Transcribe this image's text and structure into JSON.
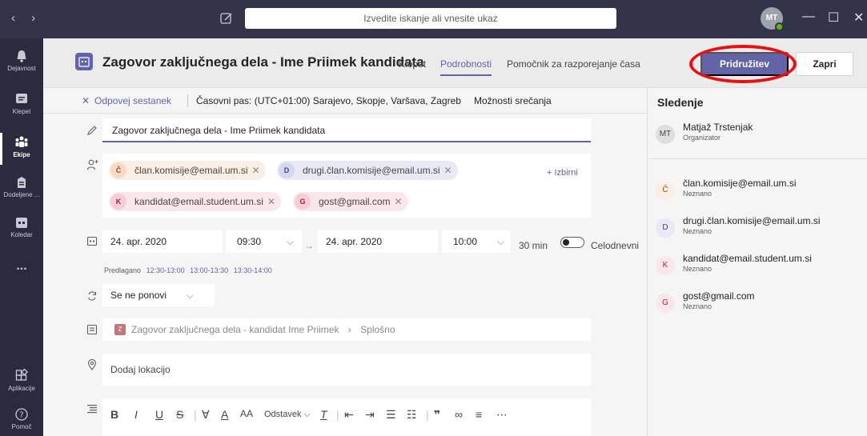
{
  "topbar": {
    "search_placeholder": "Izvedite iskanje ali vnesite ukaz",
    "user_initials": "MT",
    "nav_arrows": "‹ ›",
    "min_glyph": "—",
    "max_glyph": "☐",
    "close_glyph": "✕"
  },
  "rail": {
    "items": [
      {
        "label": "Dejavnost",
        "icon": "bell-icon"
      },
      {
        "label": "Klepet",
        "icon": "chat-icon"
      },
      {
        "label": "Ekipe",
        "icon": "teams-icon"
      },
      {
        "label": "Dodeljene ...",
        "icon": "assignments-icon"
      },
      {
        "label": "Koledar",
        "icon": "calendar-icon"
      },
      {
        "label": "...",
        "icon": "more-icon"
      },
      {
        "label": "Aplikacije",
        "icon": "apps-icon"
      },
      {
        "label": "Pomoč",
        "icon": "help-icon"
      }
    ]
  },
  "header": {
    "title": "Zagovor zaključnega dela - Ime Priimek kandidata",
    "tabs": [
      "Klepet",
      "Podrobnosti",
      "Pomočnik za razporejanje časa"
    ],
    "join_label": "Pridružitev",
    "close_label": "Zapri"
  },
  "toolbar": {
    "cancel_label": "Odpovej sestanek",
    "timezone": "Časovni pas: (UTC+01:00) Sarajevo, Skopje, Varšava, Zagreb",
    "options_label": "Možnosti srečanja"
  },
  "form": {
    "title_value": "Zagovor zaključnega dela - Ime Priimek kandidata",
    "attendees": [
      {
        "initial": "Č",
        "email": "član.komisije@email.um.si"
      },
      {
        "initial": "D",
        "email": "drugi.član.komisije@email.um.si"
      },
      {
        "initial": "K",
        "email": "kandidat@email.student.um.si"
      },
      {
        "initial": "G",
        "email": "gost@gmail.com"
      }
    ],
    "optional_label": "+ Izbirni",
    "start_date": "24. apr. 2020",
    "start_time": "09:30",
    "end_date": "24. apr. 2020",
    "end_time": "10:00",
    "duration": "30 min",
    "all_day_label": "Celodnevni",
    "suggested_label": "Predlagano",
    "suggested_slots": [
      "12:30-13:00",
      "13:00-13:30",
      "13:30-14:00"
    ],
    "repeat_value": "Se ne ponovi",
    "channel_badge": "Z",
    "channel_team": "Zagovor zaključnega dela - kandidat Ime Priimek",
    "channel_name": "Splošno",
    "location_placeholder": "Dodaj lokacijo",
    "paragraph_label": "Odstavek"
  },
  "panel": {
    "title": "Sledenje",
    "organizer": {
      "initials": "MT",
      "name": "Matjaž Trstenjak",
      "status": "Organizator"
    },
    "people": [
      {
        "initial": "Č",
        "name": "član.komisije@email.um.si",
        "status": "Neznano"
      },
      {
        "initial": "D",
        "name": "drugi.član.komisije@email.um.si",
        "status": "Neznano"
      },
      {
        "initial": "K",
        "name": "kandidat@email.student.um.si",
        "status": "Neznano"
      },
      {
        "initial": "G",
        "name": "gost@gmail.com",
        "status": "Neznano"
      }
    ]
  },
  "colors": {
    "brand": "#6264a7",
    "rail": "#2b2b40",
    "topbar": "#33344a",
    "highlight_ring": "#ea0f12"
  }
}
